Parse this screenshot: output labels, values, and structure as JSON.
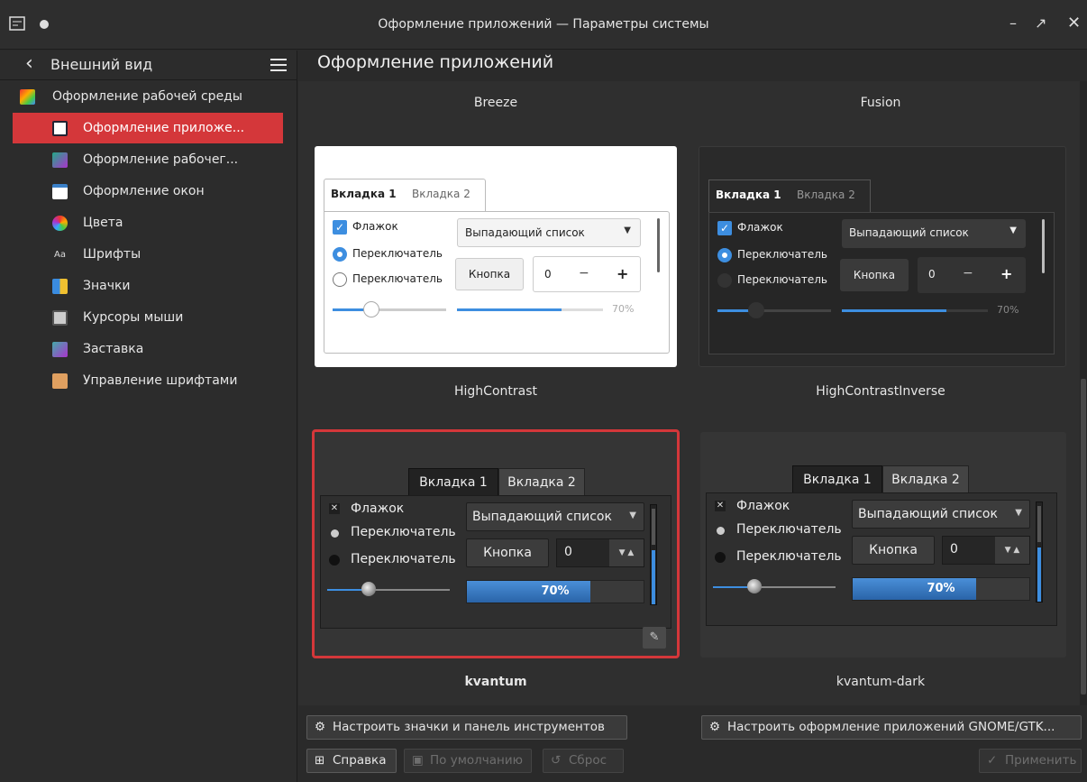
{
  "window": {
    "title": "Оформление приложений — Параметры системы"
  },
  "sidebar": {
    "header": "Внешний вид",
    "items": [
      {
        "label": "Оформление рабочей среды",
        "icon": "workspace-theme-icon"
      },
      {
        "label": "Оформление приложе...",
        "icon": "app-style-icon",
        "selected": true
      },
      {
        "label": "Оформление рабочег...",
        "icon": "plasma-style-icon"
      },
      {
        "label": "Оформление окон",
        "icon": "window-decoration-icon"
      },
      {
        "label": "Цвета",
        "icon": "colors-icon"
      },
      {
        "label": "Шрифты",
        "icon": "fonts-icon"
      },
      {
        "label": "Значки",
        "icon": "icons-icon"
      },
      {
        "label": "Курсоры мыши",
        "icon": "cursors-icon"
      },
      {
        "label": "Заставка",
        "icon": "splash-icon"
      },
      {
        "label": "Управление шрифтами",
        "icon": "font-management-icon"
      }
    ]
  },
  "main": {
    "title": "Оформление приложений",
    "styles": [
      {
        "name": "Breeze"
      },
      {
        "name": "Fusion"
      },
      {
        "name": "HighContrast"
      },
      {
        "name": "HighContrastInverse"
      },
      {
        "name": "kvantum",
        "selected": true
      },
      {
        "name": "kvantum-dark"
      }
    ],
    "preview": {
      "tab1": "Вкладка 1",
      "tab2": "Вкладка 2",
      "checkbox": "Флажок",
      "radio": "Переключатель",
      "dropdown": "Выпадающий список",
      "button": "Кнопка",
      "spin_value": "0",
      "minus": "−",
      "plus": "+",
      "progress": "70%",
      "progress_value": 0.7
    }
  },
  "buttons": {
    "configure_icons": "Настроить значки и панель инструментов",
    "configure_gtk": "Настроить оформление приложений GNOME/GTK...",
    "help": "Справка",
    "defaults": "По умолчанию",
    "reset": "Сброс",
    "apply": "Применить"
  },
  "colors": {
    "accent": "#d4373a",
    "highlight": "#3d8ee0"
  }
}
